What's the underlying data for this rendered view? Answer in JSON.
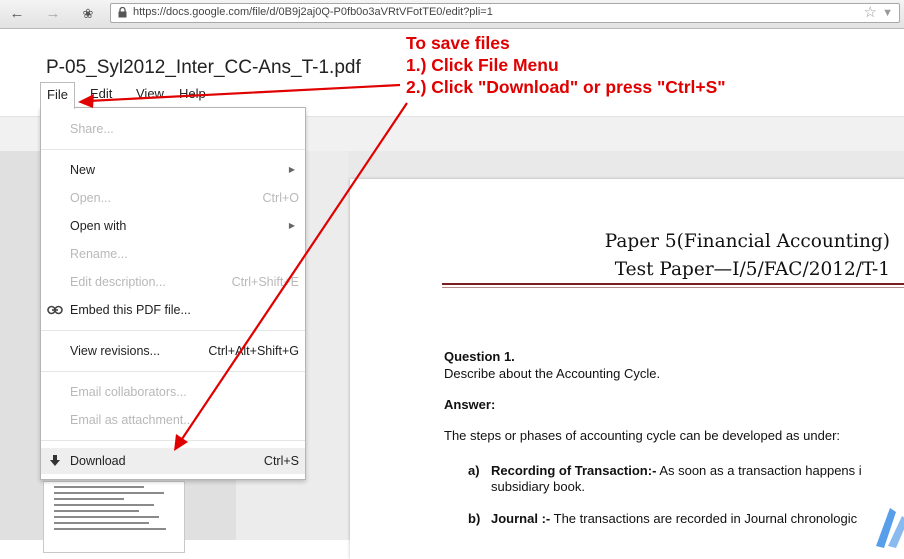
{
  "browser": {
    "url": "https://docs.google.com/file/d/0B9j2aj0Q-P0fb0o3aVRtVFotTE0/edit?pli=1"
  },
  "doc": {
    "title": "P-05_Syl2012_Inter_CC-Ans_T-1.pdf"
  },
  "menubar": {
    "items": [
      {
        "label": "File"
      },
      {
        "label": "Edit"
      },
      {
        "label": "View"
      },
      {
        "label": "Help"
      }
    ]
  },
  "file_menu": {
    "share": {
      "label": "Share...",
      "enabled": false
    },
    "new": {
      "label": "New",
      "enabled": true
    },
    "open": {
      "label": "Open...",
      "shortcut": "Ctrl+O",
      "enabled": false
    },
    "open_with": {
      "label": "Open with",
      "enabled": true
    },
    "rename": {
      "label": "Rename...",
      "enabled": false
    },
    "edit_description": {
      "label": "Edit description...",
      "shortcut": "Ctrl+Shift+E",
      "enabled": false
    },
    "embed": {
      "label": "Embed this PDF file...",
      "enabled": true,
      "icon": "link-icon"
    },
    "view_revisions": {
      "label": "View revisions...",
      "shortcut": "Ctrl+Alt+Shift+G",
      "enabled": true
    },
    "email_collaborators": {
      "label": "Email collaborators...",
      "enabled": false
    },
    "email_attachment": {
      "label": "Email as attachment...",
      "enabled": false
    },
    "download": {
      "label": "Download",
      "shortcut": "Ctrl+S",
      "enabled": true,
      "icon": "download-arrow-icon"
    }
  },
  "annotation": {
    "line1": "To save files",
    "line2": "1.) Click File Menu",
    "line3": "2.) Click \"Download\" or press \"Ctrl+S\"",
    "color": "#e00000"
  },
  "pdf": {
    "title_line1": "Paper 5(Financial Accounting)",
    "title_line2": "Test Paper—I/5/FAC/2012/T-1",
    "question_heading": "Question 1.",
    "question_text": "Describe about the Accounting Cycle.",
    "answer_heading": "Answer:",
    "answer_intro": "The steps or phases of accounting cycle can be developed as under:",
    "item_a_marker": "a)",
    "item_a_heading": "Recording of Transaction:-",
    "item_a_text": "As soon as a transaction happens i",
    "item_a_text2": "subsidiary book.",
    "item_b_marker": "b)",
    "item_b_heading": "Journal :-",
    "item_b_text": "The transactions are recorded in Journal chronologic"
  }
}
